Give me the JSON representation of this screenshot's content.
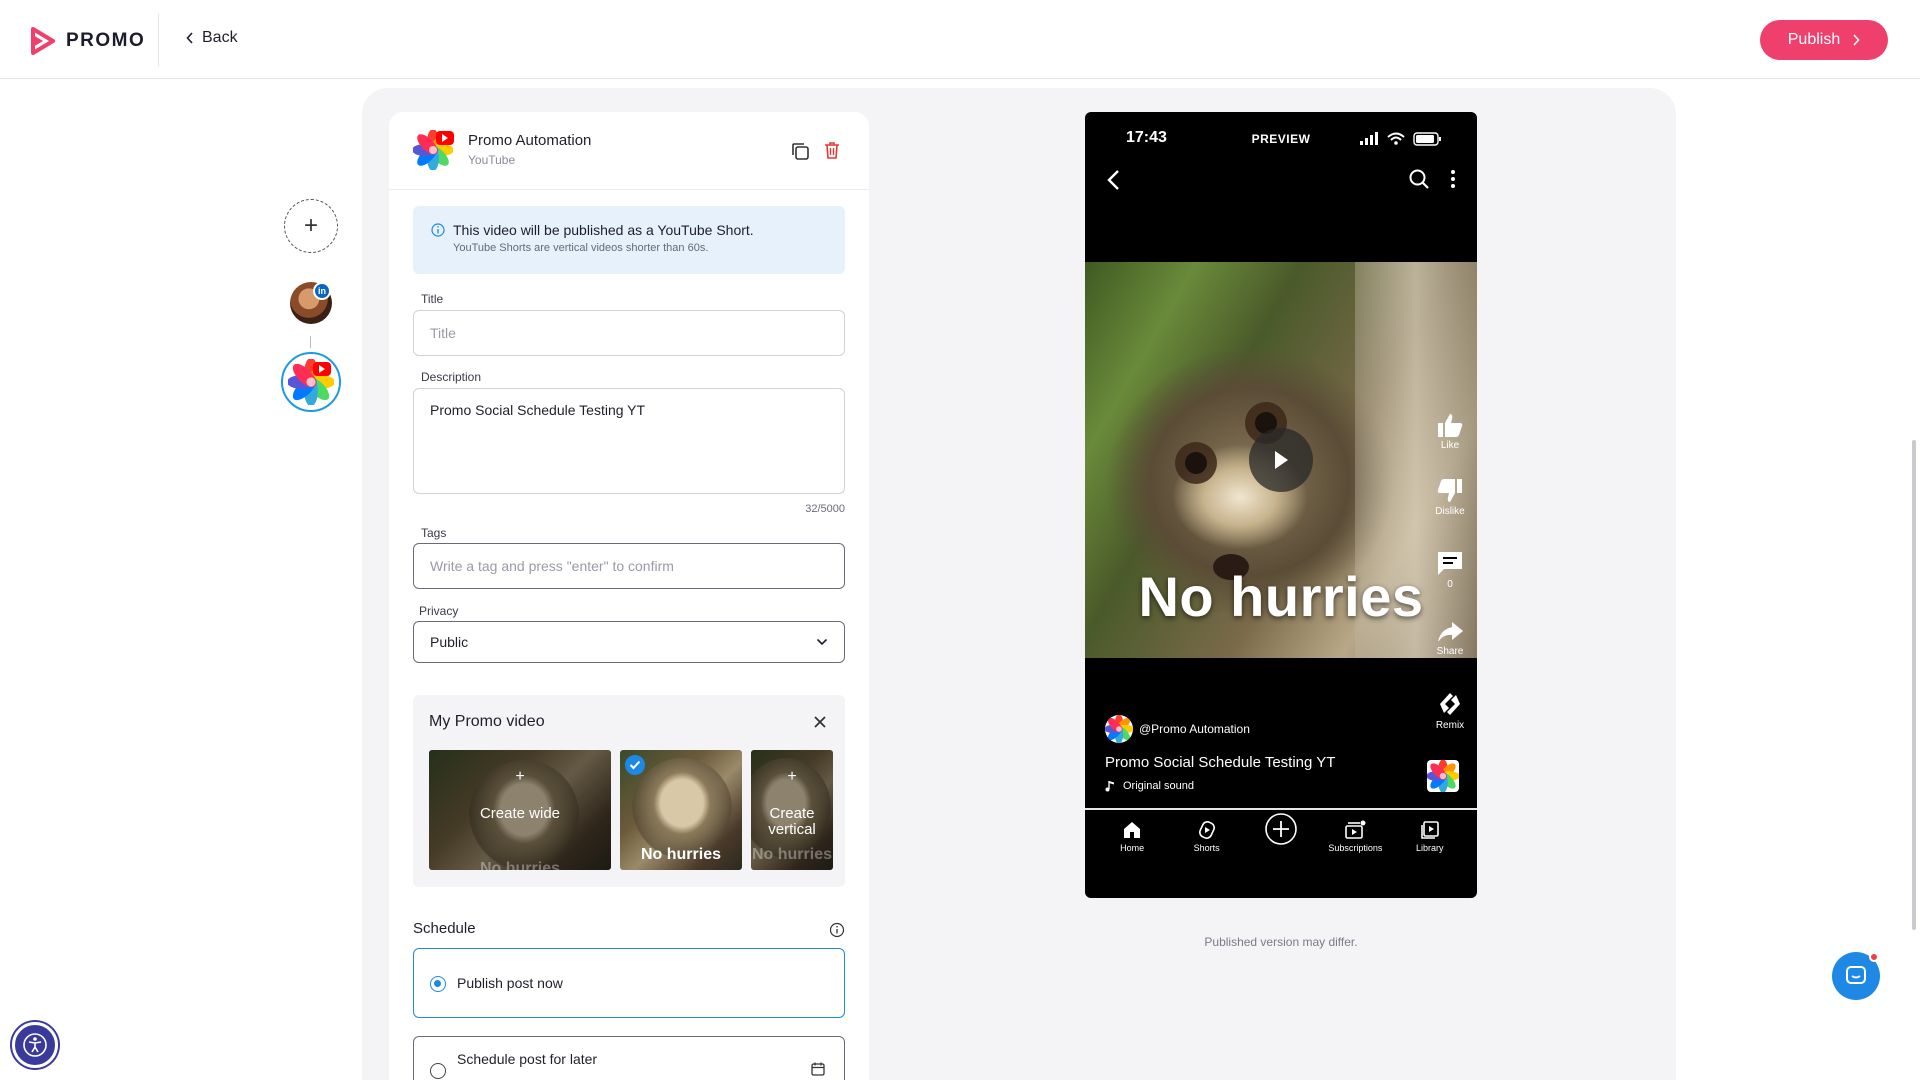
{
  "header": {
    "logo_text": "PROMO",
    "back_label": "Back",
    "publish_label": "Publish"
  },
  "rail": {
    "add_symbol": "+",
    "linkedin_badge": "in"
  },
  "account": {
    "name": "Promo Automation",
    "platform": "YouTube"
  },
  "info": {
    "title": "This video will be published as a YouTube Short.",
    "subtitle": "YouTube Shorts are vertical videos shorter than 60s."
  },
  "form": {
    "title_label": "Title",
    "title_placeholder": "Title",
    "title_value": "",
    "description_label": "Description",
    "description_value": "Promo Social Schedule Testing YT",
    "description_counter": "32/5000",
    "tags_label": "Tags",
    "tags_placeholder": "Write a tag and press \"enter\" to confirm",
    "privacy_label": "Privacy",
    "privacy_value": "Public"
  },
  "video_picker": {
    "title": "My Promo video",
    "thumbs": [
      {
        "action": "Create wide",
        "caption": "No hurries"
      },
      {
        "action": "",
        "caption": "No hurries",
        "selected": true
      },
      {
        "action": "Create vertical",
        "caption": "No hurries"
      }
    ],
    "plus": "+"
  },
  "schedule": {
    "label": "Schedule",
    "options": [
      {
        "label": "Publish post now",
        "selected": true
      },
      {
        "label": "Schedule post for later",
        "selected": false
      }
    ]
  },
  "phone": {
    "time": "17:43",
    "mode": "PREVIEW",
    "video_caption": "No hurries",
    "actions": {
      "like": "Like",
      "dislike": "Dislike",
      "comments": "0",
      "share": "Share",
      "remix": "Remix"
    },
    "channel": "@Promo Automation",
    "short_title": "Promo Social Schedule Testing YT",
    "sound": "Original sound",
    "tabs": [
      "Home",
      "Shorts",
      "",
      "Subscriptions",
      "Library"
    ]
  },
  "preview_note": "Published version may differ.",
  "colors": {
    "brand": "#ef3f6c",
    "accent": "#1e88e5",
    "info_bg": "#e6f1fb"
  }
}
